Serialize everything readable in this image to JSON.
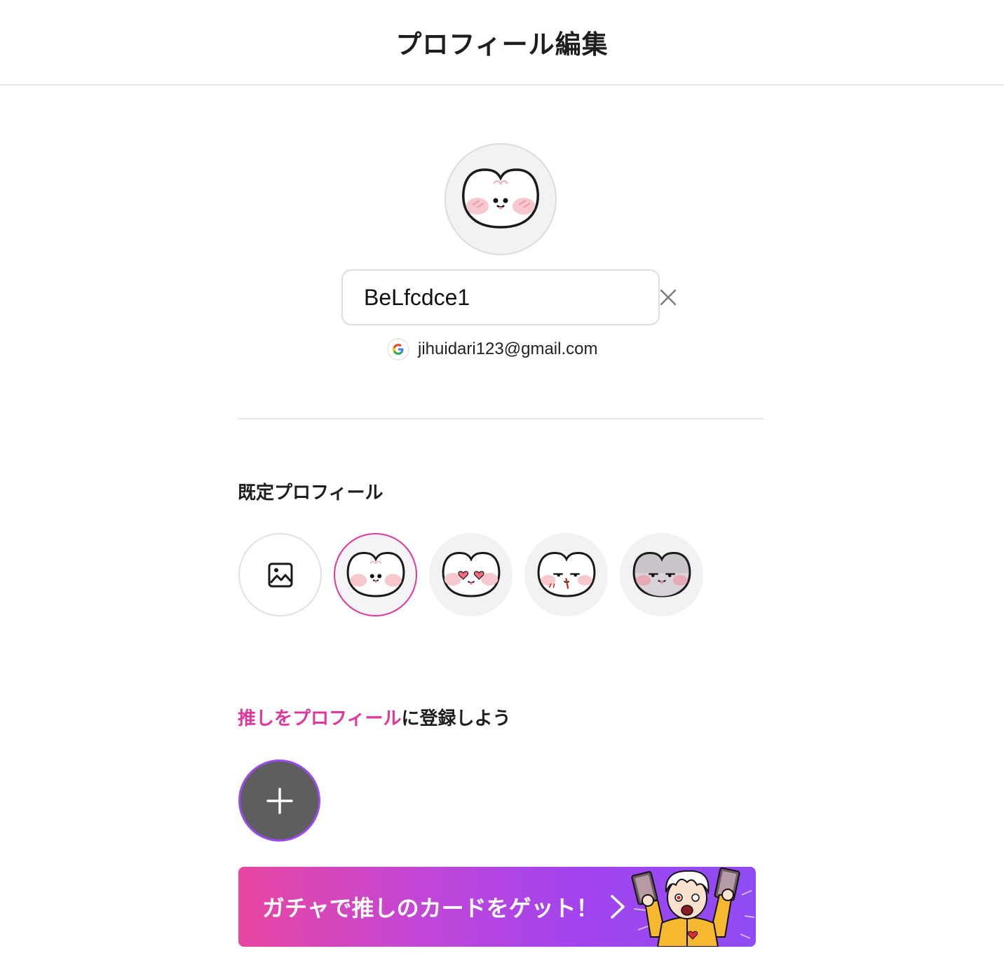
{
  "header": {
    "title": "プロフィール編集"
  },
  "profile": {
    "avatar_icon": "cat-face-icon",
    "name_value": "BeLfcdce1",
    "clear_icon": "close-icon",
    "account_provider_icon": "google-icon",
    "email": "jihuidari123@gmail.com"
  },
  "default_profile": {
    "title": "既定プロフィール",
    "items": [
      {
        "icon": "image-upload-icon",
        "selected": false
      },
      {
        "icon": "cat-face-happy-icon",
        "selected": true
      },
      {
        "icon": "cat-face-heart-eyes-icon",
        "selected": false
      },
      {
        "icon": "cat-face-nosebleed-icon",
        "selected": false
      },
      {
        "icon": "cat-face-smug-icon",
        "selected": false
      }
    ]
  },
  "oshi_section": {
    "title_highlight": "推しをプロフィール",
    "title_rest": "に登録しよう",
    "add_icon": "plus-icon"
  },
  "banner": {
    "text": "ガチャで推しのカードをゲット！",
    "arrow_icon": "chevron-right-icon",
    "art_icon": "character-illustration"
  },
  "colors": {
    "accent": "#e0389a",
    "banner_start": "#e8469f",
    "banner_end": "#8f4cf4",
    "add_border": "#9a4bf0"
  }
}
